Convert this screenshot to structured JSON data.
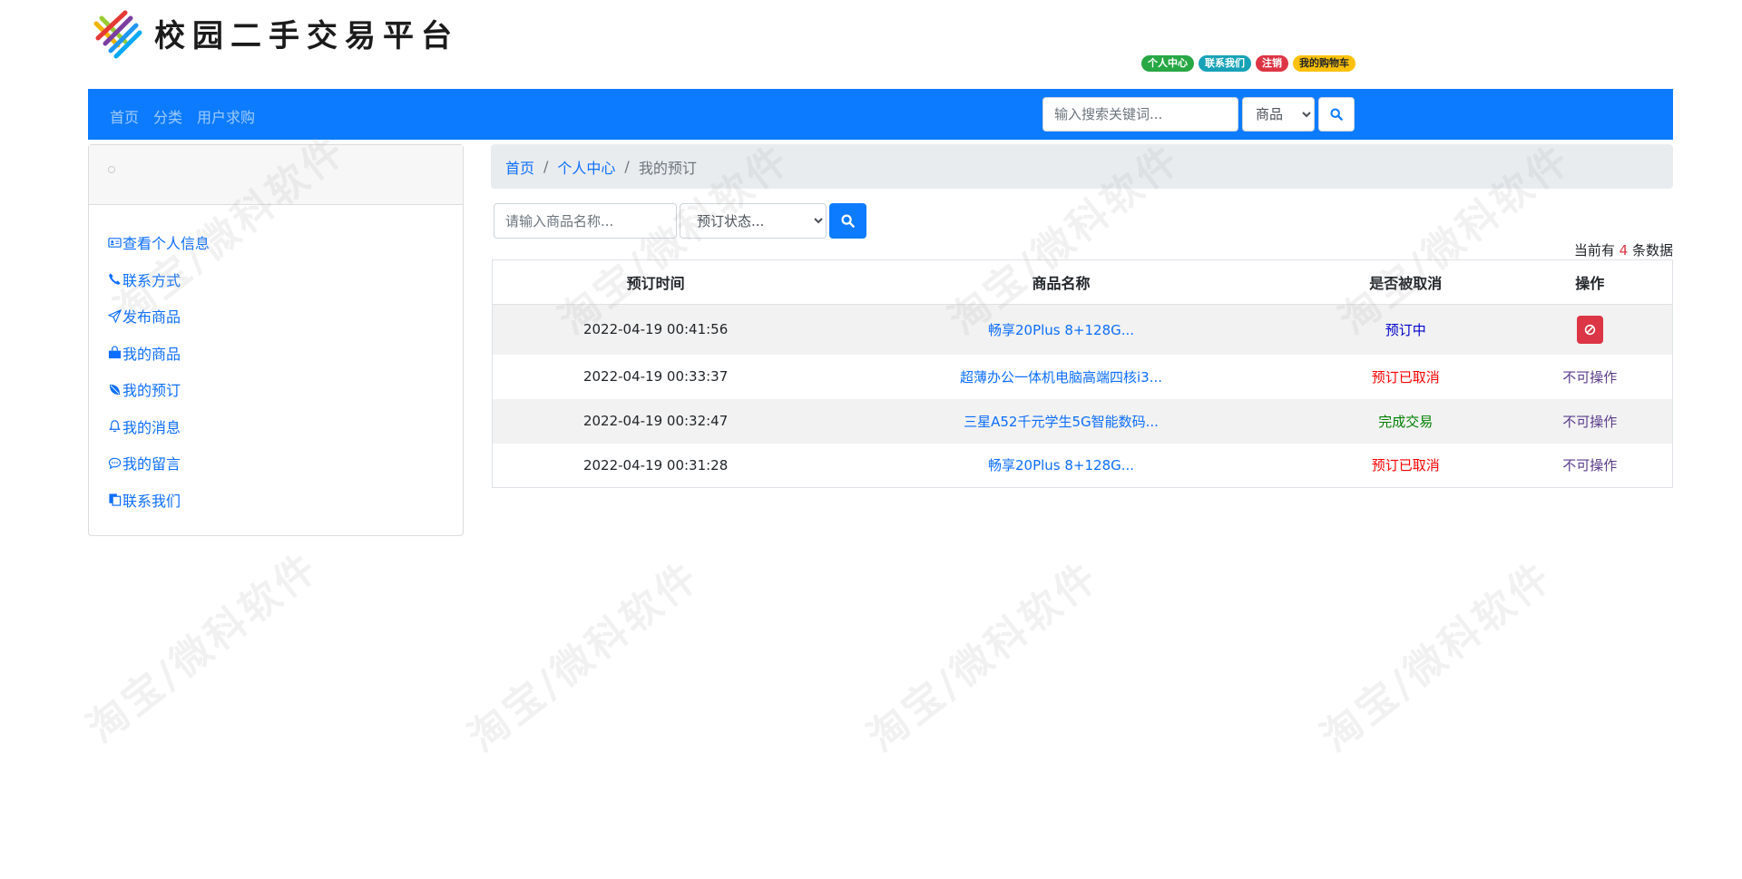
{
  "site": {
    "title": "校园二手交易平台"
  },
  "badges": [
    {
      "label": "个人中心",
      "color": "#28a745"
    },
    {
      "label": "联系我们",
      "color": "#17a2b8"
    },
    {
      "label": "注销",
      "color": "#dc3545"
    },
    {
      "label": "我的购物车",
      "color": "#ffc107"
    }
  ],
  "nav": {
    "links": [
      "首页",
      "分类",
      "用户求购"
    ],
    "search": {
      "placeholder": "输入搜索关键词...",
      "type_selected": "商品",
      "search_icon": "search-icon"
    }
  },
  "sidebar": {
    "items": [
      {
        "label": "查看个人信息",
        "icon": "id-card-icon"
      },
      {
        "label": "联系方式",
        "icon": "phone-icon"
      },
      {
        "label": "发布商品",
        "icon": "send-icon"
      },
      {
        "label": "我的商品",
        "icon": "shop-icon"
      },
      {
        "label": "我的预订",
        "icon": "leaf-icon"
      },
      {
        "label": "我的消息",
        "icon": "bell-icon"
      },
      {
        "label": "我的留言",
        "icon": "chat-icon"
      },
      {
        "label": "联系我们",
        "icon": "copy-icon"
      }
    ]
  },
  "breadcrumb": {
    "home": "首页",
    "center": "个人中心",
    "current": "我的预订",
    "separator": "/"
  },
  "filter": {
    "name_placeholder": "请输入商品名称...",
    "status_selected": "预订状态...",
    "search_icon": "search-icon"
  },
  "summary": {
    "prefix": "当前有",
    "count": "4",
    "suffix": "条数据"
  },
  "table": {
    "headers": [
      "预订时间",
      "商品名称",
      "是否被取消",
      "操作"
    ],
    "rows": [
      {
        "time": "2022-04-19 00:41:56",
        "name": "畅享20Plus 8+128G...",
        "status": "预订中",
        "status_color": "#0000cc",
        "op": "",
        "op_icon": "cancel-icon",
        "op_color": "#dc3545"
      },
      {
        "time": "2022-04-19 00:33:37",
        "name": "超薄办公一体机电脑高端四核i3...",
        "status": "预订已取消",
        "status_color": "#ff0000",
        "op": "不可操作"
      },
      {
        "time": "2022-04-19 00:32:47",
        "name": "三星A52千元学生5G智能数码...",
        "status": "完成交易",
        "status_color": "#008000",
        "op": "不可操作"
      },
      {
        "time": "2022-04-19 00:31:28",
        "name": "畅享20Plus 8+128G...",
        "status": "预订已取消",
        "status_color": "#ff0000",
        "op": "不可操作"
      }
    ]
  },
  "colors": {
    "primary": "#0d7bff",
    "link": "#0d6efd",
    "danger": "#dc3545"
  },
  "watermark": {
    "text": "淘宝/微科软件"
  }
}
